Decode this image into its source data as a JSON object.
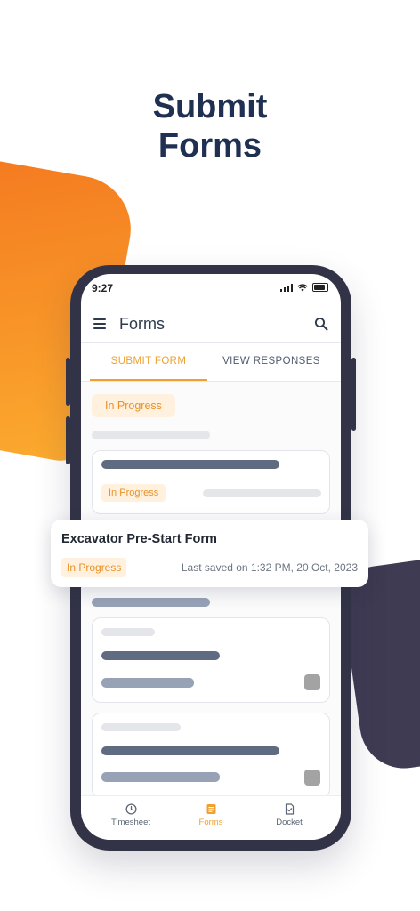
{
  "headline": {
    "line1": "Submit",
    "line2": "Forms"
  },
  "status_bar": {
    "time": "9:27"
  },
  "app_bar": {
    "title": "Forms"
  },
  "tabs": [
    {
      "label": "SUBMIT FORM",
      "active": true
    },
    {
      "label": "VIEW RESPONSES",
      "active": false
    }
  ],
  "list": {
    "section_badge": "In Progress",
    "card1_badge": "In Progress"
  },
  "floating_card": {
    "title": "Excavator Pre-Start Form",
    "status": "In Progress",
    "saved": "Last saved on 1:32 PM, 20 Oct, 2023"
  },
  "bottom_nav": [
    {
      "label": "Timesheet",
      "icon": "clock-icon",
      "active": false
    },
    {
      "label": "Forms",
      "icon": "form-icon",
      "active": true
    },
    {
      "label": "Docket",
      "icon": "document-check-icon",
      "active": false
    }
  ],
  "colors": {
    "accent": "#f0a02c",
    "headline": "#1f3052",
    "phone_frame": "#323346",
    "blob_orange": "#f47a20",
    "blob_dark": "#3f3b53"
  }
}
